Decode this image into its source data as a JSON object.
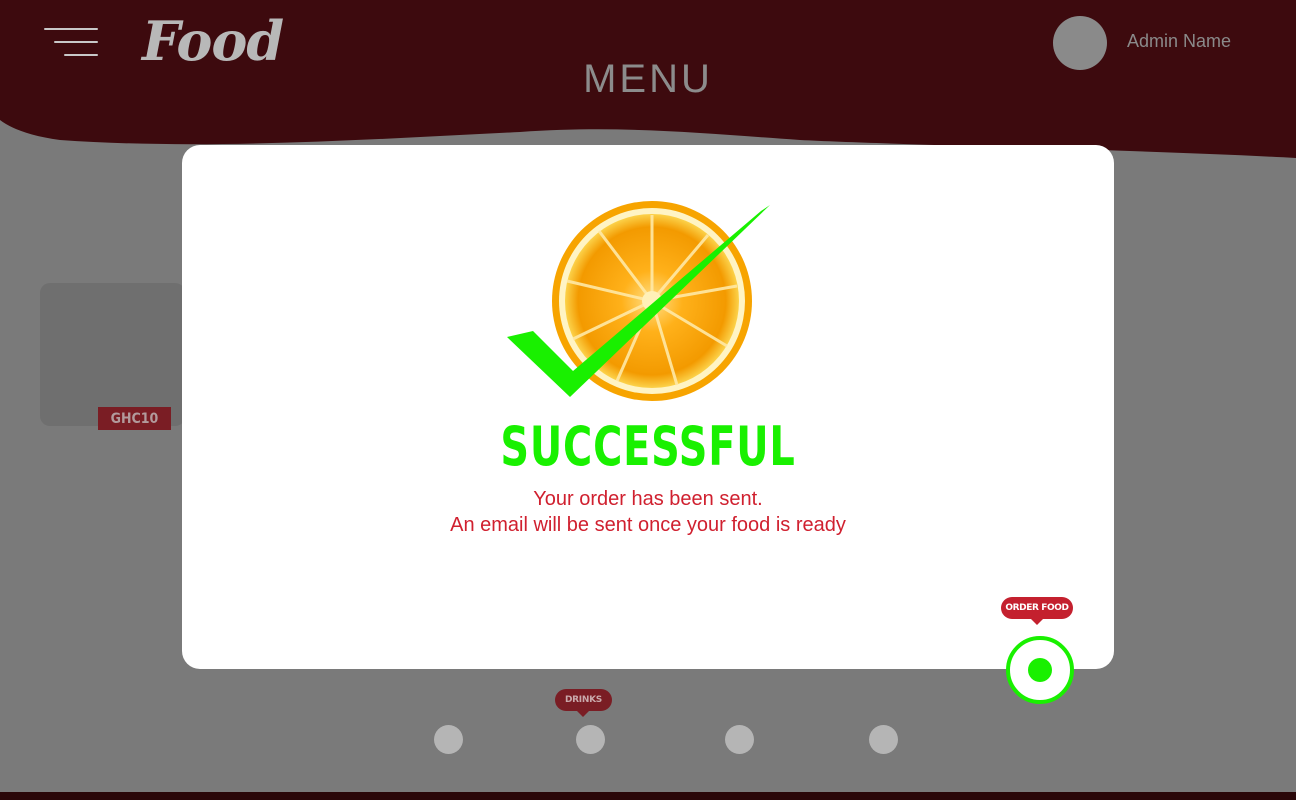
{
  "header": {
    "logo_text": "Food",
    "page_title": "MENU",
    "admin_name": "Admin Name",
    "menu_icon": "hamburger-icon"
  },
  "menu_items": [
    {
      "price": "GHC10"
    }
  ],
  "categories": [
    {
      "label": ""
    },
    {
      "label": "DRINKS"
    },
    {
      "label": ""
    },
    {
      "label": ""
    }
  ],
  "modal": {
    "icon": "orange-check-icon",
    "title": "SUCCESSFUL",
    "message_line1": "Your order has been sent.",
    "message_line2": "An email will be sent once your food is ready"
  },
  "order_button": {
    "tooltip": "ORDER FOOD",
    "icon": "radio-dot-icon"
  },
  "colors": {
    "brand_red": "#c4202e",
    "header_bg_dimmed": "#3d0a0e",
    "success_green": "#19f000",
    "overlay": "#7a7a7a"
  }
}
